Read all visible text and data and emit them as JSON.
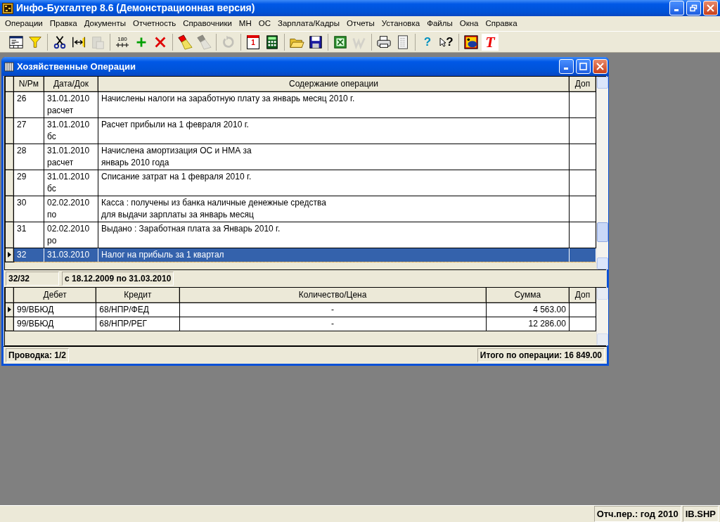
{
  "window": {
    "title": "Инфо-Бухгалтер 8.6 (Демонстрационная версия)"
  },
  "menu": [
    "Операции",
    "Правка",
    "Документы",
    "Отчетность",
    "Справочники",
    "МН",
    "ОС",
    "Зарплата/Кадры",
    "Отчеты",
    "Установка",
    "Файлы",
    "Окна",
    "Справка"
  ],
  "toolbar": [
    [
      {
        "kind": "grid",
        "disabled": false
      },
      {
        "kind": "filter",
        "disabled": false
      }
    ],
    [
      {
        "kind": "scissors",
        "disabled": false
      },
      {
        "kind": "split",
        "disabled": false
      },
      {
        "kind": "paste",
        "disabled": true
      }
    ],
    [
      {
        "kind": "numbering",
        "label": "180",
        "disabled": false
      },
      {
        "kind": "plus",
        "disabled": false
      },
      {
        "kind": "cross",
        "disabled": false
      }
    ],
    [
      {
        "kind": "flashlight",
        "disabled": false
      },
      {
        "kind": "flashlight",
        "disabled": true
      }
    ],
    [
      {
        "kind": "refresh",
        "disabled": true
      }
    ],
    [
      {
        "kind": "calendar",
        "label": "1",
        "disabled": false
      },
      {
        "kind": "calculator",
        "disabled": false
      }
    ],
    [
      {
        "kind": "folder",
        "disabled": false
      },
      {
        "kind": "save",
        "disabled": false
      }
    ],
    [
      {
        "kind": "excel",
        "disabled": false
      },
      {
        "kind": "word",
        "disabled": true
      }
    ],
    [
      {
        "kind": "printer",
        "disabled": false
      },
      {
        "kind": "document",
        "disabled": false
      }
    ],
    [
      {
        "kind": "help",
        "label": "?",
        "disabled": false
      },
      {
        "kind": "pointer_help",
        "label": "?",
        "disabled": false
      }
    ],
    [
      {
        "kind": "app",
        "disabled": false
      },
      {
        "kind": "letter",
        "label": "T",
        "disabled": false
      }
    ]
  ],
  "child_window": {
    "title": "Хозяйственные Операции",
    "operations": {
      "columns": [
        "N/Рм",
        "Дата/Док",
        "Содержание операции",
        "Доп"
      ],
      "rows": [
        {
          "number": "26",
          "date": "31.01.2010",
          "doc": "расчет",
          "content": [
            "Начислены налоги на заработную плату за январь месяц 2010 г."
          ],
          "selected": false
        },
        {
          "number": "27",
          "date": "31.01.2010",
          "doc": "бс",
          "content": [
            "Расчет прибыли на 1 февраля 2010 г."
          ],
          "selected": false
        },
        {
          "number": "28",
          "date": "31.01.2010",
          "doc": "расчет",
          "content": [
            "Начислена амортизация ОС и НМА за",
            "январь 2010 года"
          ],
          "selected": false
        },
        {
          "number": "29",
          "date": "31.01.2010",
          "doc": "бс",
          "content": [
            "Списание затрат на 1 февраля 2010 г."
          ],
          "selected": false
        },
        {
          "number": "30",
          "date": "02.02.2010",
          "doc": "по",
          "content": [
            "Касса : получены из банка наличные денежные средства",
            "для выдачи зарплаты за январь месяц"
          ],
          "selected": false
        },
        {
          "number": "31",
          "date": "02.02.2010",
          "doc": "ро",
          "content": [
            "Выдано : Заработная плата за Январь 2010 г."
          ],
          "selected": false
        },
        {
          "number": "32",
          "date": "31.03.2010",
          "doc": "",
          "content": [
            "Налог на прибыль за 1 квартал"
          ],
          "selected": true
        }
      ]
    },
    "info": {
      "count": "32/32",
      "period": "с 18.12.2009 по 31.03.2010"
    },
    "entries": {
      "columns": [
        "Дебет",
        "Кредит",
        "Количество/Цена",
        "Сумма",
        "Доп"
      ],
      "rows": [
        {
          "debit": "99/ВБЮД",
          "credit": "68/НПР/ФЕД",
          "quantity": "-",
          "amount": "4 563.00",
          "selected": true
        },
        {
          "debit": "99/ВБЮД",
          "credit": "68/НПР/РЕГ",
          "quantity": "-",
          "amount": "12 286.00",
          "selected": false
        }
      ]
    },
    "footer": {
      "entry": "Проводка: 1/2",
      "total": "Итого по операции: 16 849.00"
    }
  },
  "status_bar": [
    "Отч.пер.: год 2010",
    "IB.SHP"
  ]
}
